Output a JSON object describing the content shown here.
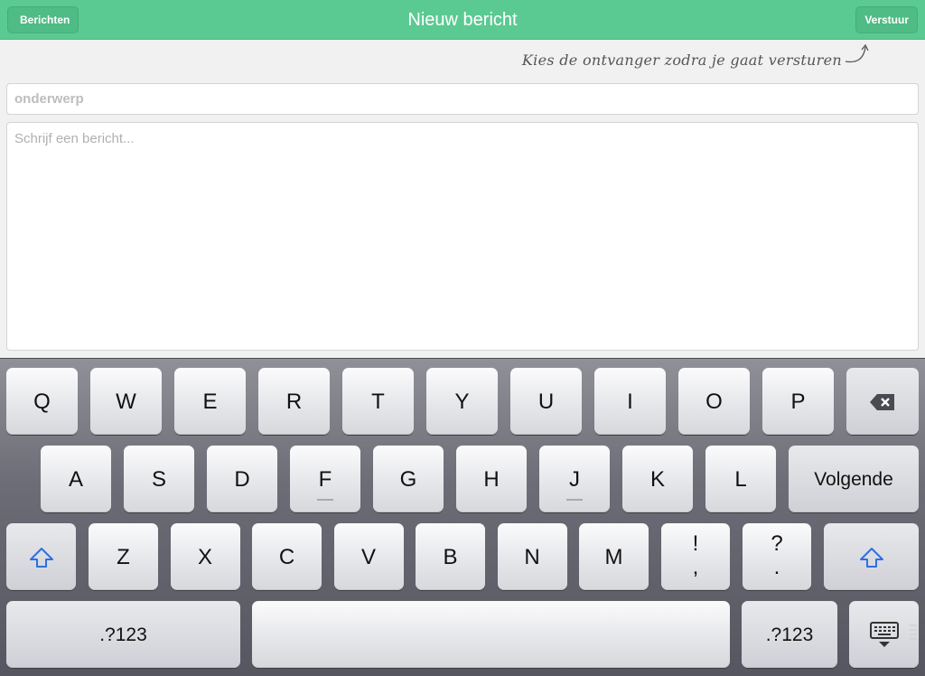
{
  "nav": {
    "title": "Nieuw bericht",
    "back_label": "Berichten",
    "send_label": "Verstuur"
  },
  "hint": "Kies de ontvanger zodra je gaat versturen",
  "subject": {
    "placeholder": "onderwerp"
  },
  "message": {
    "placeholder": "Schrijf een bericht..."
  },
  "keyboard": {
    "row1": [
      "Q",
      "W",
      "E",
      "R",
      "T",
      "Y",
      "U",
      "I",
      "O",
      "P"
    ],
    "row2": [
      "A",
      "S",
      "D",
      "F",
      "G",
      "H",
      "J",
      "K",
      "L"
    ],
    "row3": [
      "Z",
      "X",
      "C",
      "V",
      "B",
      "N",
      "M"
    ],
    "punct1": {
      "top": "!",
      "bottom": ","
    },
    "punct2": {
      "top": "?",
      "bottom": "."
    },
    "return_label": "Volgende",
    "numbers_label": ".?123",
    "icons": {
      "delete": "backspace-icon",
      "shift": "shift-icon",
      "dismiss": "keyboard-dismiss-icon"
    },
    "shift_color": "#2f6fe0"
  }
}
